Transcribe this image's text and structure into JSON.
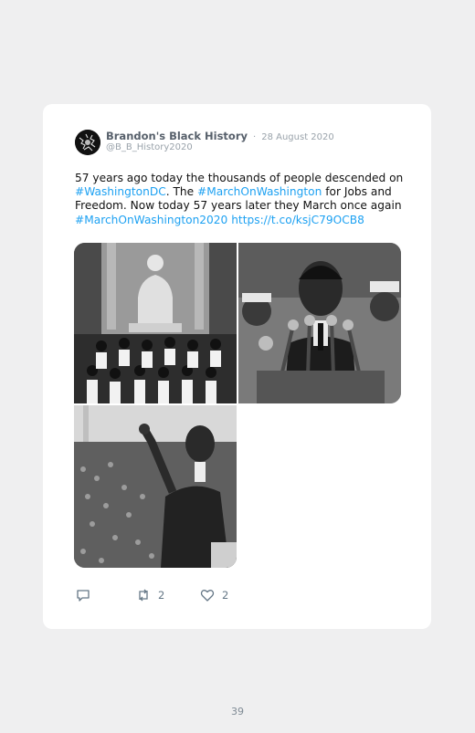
{
  "tweet": {
    "display_name": "Brandon's Black History",
    "separator": "·",
    "date": "28 August 2020",
    "handle": "@B_B_History2020",
    "text": {
      "part1": "57 years ago today the thousands of people descended on ",
      "hashtag1": "#WashingtonDC",
      "part2": ". The ",
      "hashtag2": "#MarchOnWashington",
      "part3": " for Jobs and Freedom. Now today 57 years later they March once again ",
      "hashtag3": "#MarchOnWashington2020",
      "space": " ",
      "link": "https://t.co/ksjC79OCB8"
    },
    "photos": [
      {
        "icon": "lincoln-memorial-group-photo"
      },
      {
        "icon": "king-speaking-at-microphones-photo"
      },
      {
        "icon": "king-waving-to-crowd-photo"
      }
    ],
    "actions": {
      "reply_icon": "reply-icon",
      "retweet_icon": "retweet-icon",
      "retweet_count": "2",
      "like_icon": "heart-icon",
      "like_count": "2"
    }
  },
  "page": {
    "number": "39"
  },
  "colors": {
    "hashtag": "#1da1f2",
    "name": "#57606b",
    "meta": "#9aa3ab",
    "background": "#efeff0"
  }
}
